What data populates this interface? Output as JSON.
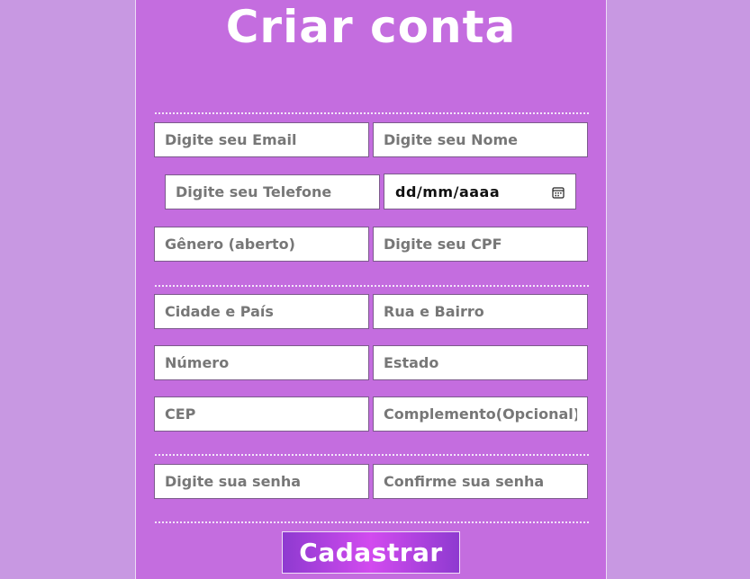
{
  "header": {
    "title": "Criar conta"
  },
  "form": {
    "email_placeholder": "Digite seu Email",
    "name_placeholder": "Digite seu Nome",
    "phone_placeholder": "Digite seu Telefone",
    "date_placeholder": "dd/mm/aaaa",
    "gender_placeholder": "Gênero (aberto)",
    "cpf_placeholder": "Digite seu CPF",
    "city_placeholder": "Cidade e País",
    "street_placeholder": "Rua e Bairro",
    "number_placeholder": "Número",
    "state_placeholder": "Estado",
    "cep_placeholder": "CEP",
    "complement_placeholder": "Complemento(Opcional)",
    "password_placeholder": "Digite sua senha",
    "confirm_password_placeholder": "Confirme sua senha",
    "submit_label": "Cadastrar"
  },
  "icons": {
    "date_picker": "calendar-icon"
  },
  "colors": {
    "background": "#c898e2",
    "panel": "#c46ddf",
    "button_gradient_start": "#8e3ad0",
    "button_gradient_mid": "#d24bef"
  }
}
